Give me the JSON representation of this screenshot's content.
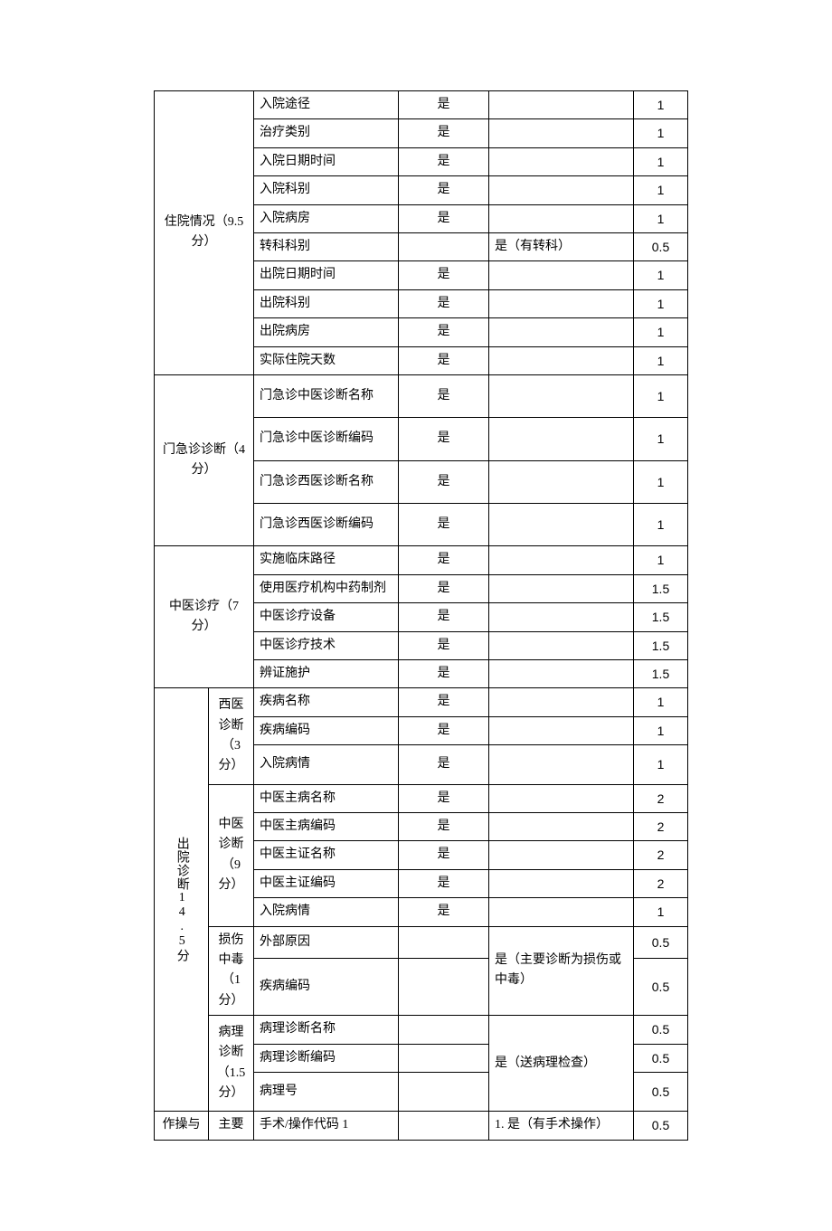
{
  "sections": {
    "hosp": {
      "label": "住院情况（9.5 分）"
    },
    "outpatient": {
      "label": "门急诊诊断（4 分）"
    },
    "tcm": {
      "label": "中医诊疗（7 分）"
    },
    "discharge": {
      "label": "出院诊断14.5分"
    },
    "discharge_west": {
      "label": "西医诊断（3 分）"
    },
    "discharge_tcm": {
      "label": "中医诊断（9 分）"
    },
    "discharge_injury": {
      "label": "损伤中毒（1 分）"
    },
    "discharge_path": {
      "label": "病理诊断（1.5 分）"
    },
    "operation": {
      "label": "作操与"
    },
    "op_main": {
      "label": "主要"
    }
  },
  "rows": {
    "r1": {
      "item": "入院途径",
      "req": "是",
      "cond": "",
      "score": "1"
    },
    "r2": {
      "item": "治疗类别",
      "req": "是",
      "cond": "",
      "score": "1"
    },
    "r3": {
      "item": "入院日期时间",
      "req": "是",
      "cond": "",
      "score": "1"
    },
    "r4": {
      "item": "入院科别",
      "req": "是",
      "cond": "",
      "score": "1"
    },
    "r5": {
      "item": "入院病房",
      "req": "是",
      "cond": "",
      "score": "1"
    },
    "r6": {
      "item": "转科科别",
      "req": "",
      "cond": "是（有转科）",
      "score": "0.5"
    },
    "r7": {
      "item": "出院日期时间",
      "req": "是",
      "cond": "",
      "score": "1"
    },
    "r8": {
      "item": "出院科别",
      "req": "是",
      "cond": "",
      "score": "1"
    },
    "r9": {
      "item": "出院病房",
      "req": "是",
      "cond": "",
      "score": "1"
    },
    "r10": {
      "item": "实际住院天数",
      "req": "是",
      "cond": "",
      "score": "1"
    },
    "r11": {
      "item": "门急诊中医诊断名称",
      "req": "是",
      "cond": "",
      "score": "1"
    },
    "r12": {
      "item": "门急诊中医诊断编码",
      "req": "是",
      "cond": "",
      "score": "1"
    },
    "r13": {
      "item": "门急诊西医诊断名称",
      "req": "是",
      "cond": "",
      "score": "1"
    },
    "r14": {
      "item": "门急诊西医诊断编码",
      "req": "是",
      "cond": "",
      "score": "1"
    },
    "r15": {
      "item": "实施临床路径",
      "req": "是",
      "cond": "",
      "score": "1"
    },
    "r16": {
      "item": "使用医疗机构中药制剂",
      "req": "是",
      "cond": "",
      "score": "1.5"
    },
    "r17": {
      "item": "中医诊疗设备",
      "req": "是",
      "cond": "",
      "score": "1.5"
    },
    "r18": {
      "item": "中医诊疗技术",
      "req": "是",
      "cond": "",
      "score": "1.5"
    },
    "r19": {
      "item": "辨证施护",
      "req": "是",
      "cond": "",
      "score": "1.5"
    },
    "r20": {
      "item": "疾病名称",
      "req": "是",
      "cond": "",
      "score": "1"
    },
    "r21": {
      "item": "疾病编码",
      "req": "是",
      "cond": "",
      "score": "1"
    },
    "r22": {
      "item": "入院病情",
      "req": "是",
      "cond": "",
      "score": "1"
    },
    "r23": {
      "item": "中医主病名称",
      "req": "是",
      "cond": "",
      "score": "2"
    },
    "r24": {
      "item": "中医主病编码",
      "req": "是",
      "cond": "",
      "score": "2"
    },
    "r25": {
      "item": "中医主证名称",
      "req": "是",
      "cond": "",
      "score": "2"
    },
    "r26": {
      "item": "中医主证编码",
      "req": "是",
      "cond": "",
      "score": "2"
    },
    "r27": {
      "item": "入院病情",
      "req": "是",
      "cond": "",
      "score": "1"
    },
    "r28": {
      "item": "外部原因",
      "req": "",
      "cond": "",
      "score": "0.5"
    },
    "r29": {
      "item": "疾病编码",
      "req": "",
      "cond": "是（主要诊断为损伤或中毒）",
      "score": "0.5"
    },
    "r30": {
      "item": "病理诊断名称",
      "req": "",
      "cond": "",
      "score": "0.5"
    },
    "r31": {
      "item": "病理诊断编码",
      "req": "",
      "cond": "是（送病理检查）",
      "score": "0.5"
    },
    "r32": {
      "item": "病理号",
      "req": "",
      "cond": "",
      "score": "0.5"
    },
    "r33": {
      "item": "手术/操作代码 1",
      "req": "",
      "cond": "1. 是（有手术操作）",
      "score": "0.5"
    }
  }
}
